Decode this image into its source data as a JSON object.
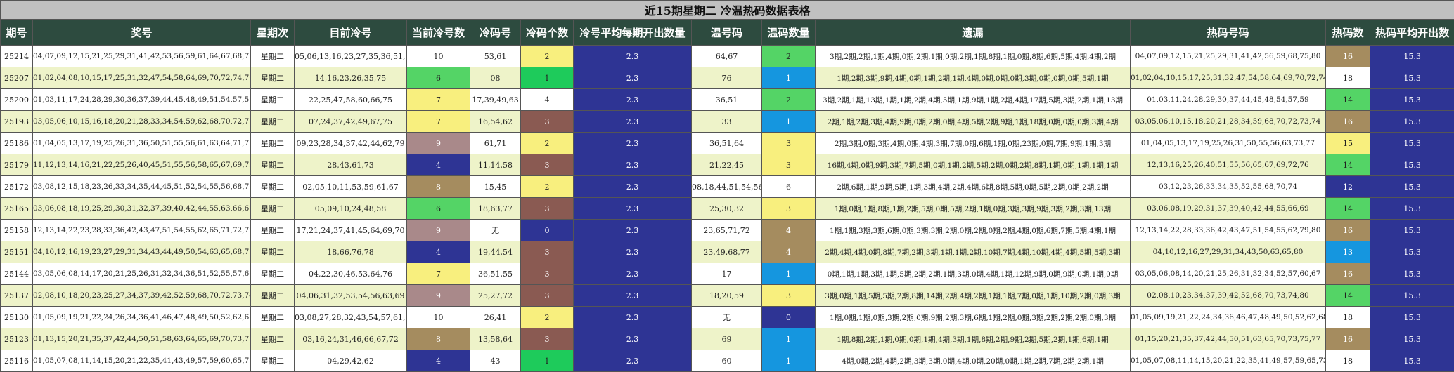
{
  "title": "近15期星期二 冷温热码数据表格",
  "headers": [
    "期号",
    "奖号",
    "星期次",
    "目前冷号",
    "当前冷号数",
    "冷码号",
    "冷码个数",
    "冷号平均每期开出数量",
    "温号码",
    "温码数量",
    "遗漏",
    "热码号码",
    "热码数",
    "热码平均开出数"
  ],
  "colors": {
    "white": "#ffffff",
    "green": "#54d466",
    "green2": "#1ecb5b",
    "yellow": "#f8ef7e",
    "brown": "#8a5a52",
    "tan": "#a58c5f",
    "mauve": "#a9898a",
    "navy": "#2e3494",
    "blue": "#1596df",
    "header_bg": "#2d4b3f",
    "title_bg": "#c0c0c0"
  },
  "rows": [
    {
      "issue": "25214",
      "nums": "04,07,09,12,15,21,25,29,31,41,42,53,56,59,61,64,67,68,75,80",
      "day": "星期二",
      "cold_now": "05,06,13,16,23,27,35,36,51,60",
      "cold_cnt": "10",
      "cold_cnt_color": "white",
      "cold_code": "53,61",
      "cold_num": "2",
      "cold_num_color": "yellow",
      "cold_avg": "2.3",
      "warm_code": "64,67",
      "warm_num": "2",
      "warm_num_color": "green",
      "miss": "3期,2期,2期,1期,4期,0期,2期,1期,0期,2期,1期,8期,1期,0期,8期,6期,5期,4期,4期,2期",
      "hot_code": "04,07,09,12,15,21,25,29,31,41,42,56,59,68,75,80",
      "hot_num": "16",
      "hot_num_color": "tan",
      "hot_avg": "15.3",
      "bg": "#ffffff"
    },
    {
      "issue": "25207",
      "nums": "01,02,04,08,10,15,17,25,31,32,47,54,58,64,69,70,72,74,76,78",
      "day": "星期二",
      "cold_now": "14,16,23,26,35,75",
      "cold_cnt": "6",
      "cold_cnt_color": "green",
      "cold_code": "08",
      "cold_num": "1",
      "cold_num_color": "green2",
      "cold_avg": "2.3",
      "warm_code": "76",
      "warm_num": "1",
      "warm_num_color": "sky",
      "miss": "1期,2期,3期,9期,4期,0期,1期,2期,1期,4期,0期,0期,0期,3期,0期,0期,0期,5期,1期",
      "hot_code": "01,02,04,10,15,17,25,31,32,47,54,58,64,69,70,72,74,78",
      "hot_num": "18",
      "hot_num_color": "white",
      "hot_avg": "15.3",
      "bg": "#eef3c9"
    },
    {
      "issue": "25200",
      "nums": "01,03,11,17,24,28,29,30,36,37,39,44,45,48,49,51,54,57,59,63",
      "day": "星期二",
      "cold_now": "22,25,47,58,60,66,75",
      "cold_cnt": "7",
      "cold_cnt_color": "yellow",
      "cold_code": "17,39,49,63",
      "cold_num": "4",
      "cold_num_color": "white",
      "cold_avg": "2.3",
      "warm_code": "36,51",
      "warm_num": "2",
      "warm_num_color": "green",
      "miss": "3期,2期,1期,13期,1期,1期,2期,4期,5期,1期,9期,1期,2期,4期,17期,5期,3期,2期,1期,13期",
      "hot_code": "01,03,11,24,28,29,30,37,44,45,48,54,57,59",
      "hot_num": "14",
      "hot_num_color": "green",
      "hot_avg": "15.3",
      "bg": "#ffffff"
    },
    {
      "issue": "25193",
      "nums": "03,05,06,10,15,16,18,20,21,28,33,34,54,59,62,68,70,72,73,74",
      "day": "星期二",
      "cold_now": "07,24,37,42,49,67,75",
      "cold_cnt": "7",
      "cold_cnt_color": "yellow",
      "cold_code": "16,54,62",
      "cold_num": "3",
      "cold_num_color": "brown",
      "cold_avg": "2.3",
      "warm_code": "33",
      "warm_num": "1",
      "warm_num_color": "sky",
      "miss": "2期,1期,2期,3期,4期,9期,0期,2期,0期,4期,5期,2期,9期,1期,18期,0期,0期,0期,3期,4期",
      "hot_code": "03,05,06,10,15,18,20,21,28,34,59,68,70,72,73,74",
      "hot_num": "16",
      "hot_num_color": "tan",
      "hot_avg": "15.3",
      "bg": "#eef3c9"
    },
    {
      "issue": "25186",
      "nums": "01,04,05,13,17,19,25,26,31,36,50,51,55,56,61,63,64,71,73,77",
      "day": "星期二",
      "cold_now": "09,23,28,34,37,42,44,62,79",
      "cold_cnt": "9",
      "cold_cnt_color": "mauve",
      "cold_code": "61,71",
      "cold_num": "2",
      "cold_num_color": "yellow",
      "cold_avg": "2.3",
      "warm_code": "36,51,64",
      "warm_num": "3",
      "warm_num_color": "yellow",
      "miss": "2期,3期,0期,3期,4期,0期,4期,3期,7期,0期,6期,1期,0期,23期,0期,7期,9期,1期,3期",
      "hot_code": "01,04,05,13,17,19,25,26,31,50,55,56,63,73,77",
      "hot_num": "15",
      "hot_num_color": "yellow",
      "hot_avg": "15.3",
      "bg": "#ffffff"
    },
    {
      "issue": "25179",
      "nums": "11,12,13,14,16,21,22,25,26,40,45,51,55,56,58,65,67,69,72,76",
      "day": "星期二",
      "cold_now": "28,43,61,73",
      "cold_cnt": "4",
      "cold_cnt_color": "navy",
      "cold_code": "11,14,58",
      "cold_num": "3",
      "cold_num_color": "brown",
      "cold_avg": "2.3",
      "warm_code": "21,22,45",
      "warm_num": "3",
      "warm_num_color": "yellow",
      "miss": "16期,4期,0期,9期,3期,7期,5期,0期,1期,2期,5期,2期,0期,2期,8期,1期,0期,1期,1期,1期",
      "hot_code": "12,13,16,25,26,40,51,55,56,65,67,69,72,76",
      "hot_num": "14",
      "hot_num_color": "green",
      "hot_avg": "15.3",
      "bg": "#eef3c9"
    },
    {
      "issue": "25172",
      "nums": "03,08,12,15,18,23,26,33,34,35,44,45,51,52,54,55,56,68,70,74",
      "day": "星期二",
      "cold_now": "02,05,10,11,53,59,61,67",
      "cold_cnt": "8",
      "cold_cnt_color": "tan",
      "cold_code": "15,45",
      "cold_num": "2",
      "cold_num_color": "yellow",
      "cold_avg": "2.3",
      "warm_code": "08,18,44,51,54,56",
      "warm_num": "6",
      "warm_num_color": "white",
      "miss": "2期,6期,1期,9期,5期,1期,3期,4期,2期,4期,6期,8期,5期,0期,5期,2期,0期,2期,2期",
      "hot_code": "03,12,23,26,33,34,35,52,55,68,70,74",
      "hot_num": "12",
      "hot_num_color": "navy",
      "hot_avg": "15.3",
      "bg": "#ffffff"
    },
    {
      "issue": "25165",
      "nums": "03,06,08,18,19,25,29,30,31,32,37,39,40,42,44,55,63,66,69,77",
      "day": "星期二",
      "cold_now": "05,09,10,24,48,58",
      "cold_cnt": "6",
      "cold_cnt_color": "green",
      "cold_code": "18,63,77",
      "cold_num": "3",
      "cold_num_color": "brown",
      "cold_avg": "2.3",
      "warm_code": "25,30,32",
      "warm_num": "3",
      "warm_num_color": "yellow",
      "miss": "1期,0期,1期,8期,1期,2期,5期,0期,5期,2期,1期,0期,3期,3期,9期,3期,2期,3期,13期",
      "hot_code": "03,06,08,19,29,31,37,39,40,42,44,55,66,69",
      "hot_num": "14",
      "hot_num_color": "green",
      "hot_avg": "15.3",
      "bg": "#eef3c9"
    },
    {
      "issue": "25158",
      "nums": "12,13,14,22,23,28,33,36,42,43,47,51,54,55,62,65,71,72,79,80",
      "day": "星期二",
      "cold_now": "17,21,24,37,41,45,64,69,70",
      "cold_cnt": "9",
      "cold_cnt_color": "mauve",
      "cold_code": "无",
      "cold_num": "0",
      "cold_num_color": "navy",
      "cold_avg": "2.3",
      "warm_code": "23,65,71,72",
      "warm_num": "4",
      "warm_num_color": "tan",
      "miss": "1期,1期,3期,3期,6期,0期,3期,3期,2期,0期,2期,0期,2期,4期,0期,6期,7期,5期,4期,1期",
      "hot_code": "12,13,14,22,28,33,36,42,43,47,51,54,55,62,79,80",
      "hot_num": "16",
      "hot_num_color": "tan",
      "hot_avg": "15.3",
      "bg": "#ffffff"
    },
    {
      "issue": "25151",
      "nums": "04,10,12,16,19,23,27,29,31,34,43,44,49,50,54,63,65,68,77,80",
      "day": "星期二",
      "cold_now": "18,66,76,78",
      "cold_cnt": "4",
      "cold_cnt_color": "navy",
      "cold_code": "19,44,54",
      "cold_num": "3",
      "cold_num_color": "brown",
      "cold_avg": "2.3",
      "warm_code": "23,49,68,77",
      "warm_num": "4",
      "warm_num_color": "tan",
      "miss": "2期,4期,4期,0期,8期,7期,2期,3期,1期,1期,2期,10期,7期,4期,10期,4期,4期,5期,5期,3期",
      "hot_code": "04,10,12,16,27,29,31,34,43,50,63,65,80",
      "hot_num": "13",
      "hot_num_color": "blue",
      "hot_avg": "15.3",
      "bg": "#eef3c9"
    },
    {
      "issue": "25144",
      "nums": "03,05,06,08,14,17,20,21,25,26,31,32,34,36,51,52,55,57,60,67",
      "day": "星期二",
      "cold_now": "04,22,30,46,53,64,76",
      "cold_cnt": "7",
      "cold_cnt_color": "yellow",
      "cold_code": "36,51,55",
      "cold_num": "3",
      "cold_num_color": "brown",
      "cold_avg": "2.3",
      "warm_code": "17",
      "warm_num": "1",
      "warm_num_color": "sky",
      "miss": "0期,1期,1期,3期,1期,5期,2期,2期,1期,3期,0期,4期,1期,12期,9期,0期,9期,0期,1期,0期",
      "hot_code": "03,05,06,08,14,20,21,25,26,31,32,34,52,57,60,67",
      "hot_num": "16",
      "hot_num_color": "tan",
      "hot_avg": "15.3",
      "bg": "#ffffff"
    },
    {
      "issue": "25137",
      "nums": "02,08,10,18,20,23,25,27,34,37,39,42,52,59,68,70,72,73,74,80",
      "day": "星期二",
      "cold_now": "04,06,31,32,53,54,56,63,69",
      "cold_cnt": "9",
      "cold_cnt_color": "mauve",
      "cold_code": "25,27,72",
      "cold_num": "3",
      "cold_num_color": "brown",
      "cold_avg": "2.3",
      "warm_code": "18,20,59",
      "warm_num": "3",
      "warm_num_color": "yellow",
      "miss": "3期,0期,1期,5期,5期,2期,8期,14期,2期,4期,2期,1期,1期,7期,0期,1期,10期,2期,0期,3期",
      "hot_code": "02,08,10,23,34,37,39,42,52,68,70,73,74,80",
      "hot_num": "14",
      "hot_num_color": "green",
      "hot_avg": "15.3",
      "bg": "#eef3c9"
    },
    {
      "issue": "25130",
      "nums": "01,05,09,19,21,22,24,26,34,36,41,46,47,48,49,50,52,62,68,75",
      "day": "星期二",
      "cold_now": "03,08,27,28,32,43,54,57,61,74",
      "cold_cnt": "10",
      "cold_cnt_color": "white",
      "cold_code": "26,41",
      "cold_num": "2",
      "cold_num_color": "yellow",
      "cold_avg": "2.3",
      "warm_code": "无",
      "warm_num": "0",
      "warm_num_color": "navy",
      "miss": "1期,0期,1期,0期,3期,2期,0期,9期,2期,3期,6期,1期,2期,0期,3期,2期,2期,2期,0期,3期",
      "hot_code": "01,05,09,19,21,22,24,34,36,46,47,48,49,50,52,62,68,75",
      "hot_num": "18",
      "hot_num_color": "white",
      "hot_avg": "15.3",
      "bg": "#ffffff"
    },
    {
      "issue": "25123",
      "nums": "01,13,15,20,21,35,37,42,44,50,51,58,63,64,65,69,70,73,75,77",
      "day": "星期二",
      "cold_now": "03,16,24,31,46,66,67,72",
      "cold_cnt": "8",
      "cold_cnt_color": "tan",
      "cold_code": "13,58,64",
      "cold_num": "3",
      "cold_num_color": "brown",
      "cold_avg": "2.3",
      "warm_code": "69",
      "warm_num": "1",
      "warm_num_color": "sky",
      "miss": "1期,8期,2期,1期,0期,0期,1期,4期,3期,1期,8期,2期,9期,2期,5期,2期,1期,6期,1期",
      "hot_code": "01,15,20,21,35,37,42,44,50,51,63,65,70,73,75,77",
      "hot_num": "16",
      "hot_num_color": "tan",
      "hot_avg": "15.3",
      "bg": "#eef3c9"
    },
    {
      "issue": "25116",
      "nums": "01,05,07,08,11,14,15,20,21,22,35,41,43,49,57,59,60,65,73,80",
      "day": "星期二",
      "cold_now": "04,29,42,62",
      "cold_cnt": "4",
      "cold_cnt_color": "navy",
      "cold_code": "43",
      "cold_num": "1",
      "cold_num_color": "green2",
      "cold_avg": "2.3",
      "warm_code": "60",
      "warm_num": "1",
      "warm_num_color": "sky",
      "miss": "4期,0期,2期,4期,2期,3期,3期,0期,4期,0期,20期,0期,1期,2期,7期,2期,2期,1期",
      "hot_code": "01,05,07,08,11,14,15,20,21,22,35,41,49,57,59,65,73,80",
      "hot_num": "18",
      "hot_num_color": "white",
      "hot_avg": "15.3",
      "bg": "#ffffff"
    }
  ]
}
